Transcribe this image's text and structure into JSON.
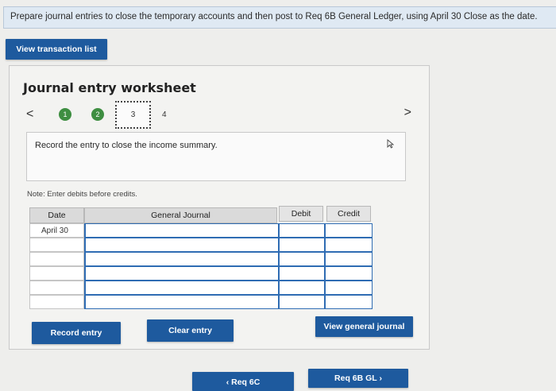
{
  "instruction": "Prepare journal entries to close the temporary accounts and then post to Req 6B General Ledger, using April 30 Close as the date.",
  "buttons": {
    "view_transaction_list": "View transaction list",
    "record_entry": "Record entry",
    "clear_entry": "Clear entry",
    "view_general_journal": "View general journal",
    "req_prev": "‹  Req 6C",
    "req_next": "Req 6B GL  ›"
  },
  "worksheet": {
    "title": "Journal entry worksheet",
    "prev_arrow": "<",
    "next_arrow": ">",
    "steps": [
      "1",
      "2",
      "3",
      "4"
    ],
    "active_step": "3",
    "record_instruction": "Record the entry to close the income summary.",
    "note": "Note: Enter debits before credits."
  },
  "table": {
    "headers": {
      "date": "Date",
      "general_journal": "General Journal",
      "debit": "Debit",
      "credit": "Credit"
    },
    "rows": [
      {
        "date": "April 30",
        "account": "",
        "debit": "",
        "credit": ""
      },
      {
        "date": "",
        "account": "",
        "debit": "",
        "credit": ""
      },
      {
        "date": "",
        "account": "",
        "debit": "",
        "credit": ""
      },
      {
        "date": "",
        "account": "",
        "debit": "",
        "credit": ""
      },
      {
        "date": "",
        "account": "",
        "debit": "",
        "credit": ""
      },
      {
        "date": "",
        "account": "",
        "debit": "",
        "credit": ""
      }
    ]
  },
  "colors": {
    "primary_button": "#1e5a9e",
    "step_complete": "#3e8e41",
    "input_border": "#2f6cb3"
  }
}
